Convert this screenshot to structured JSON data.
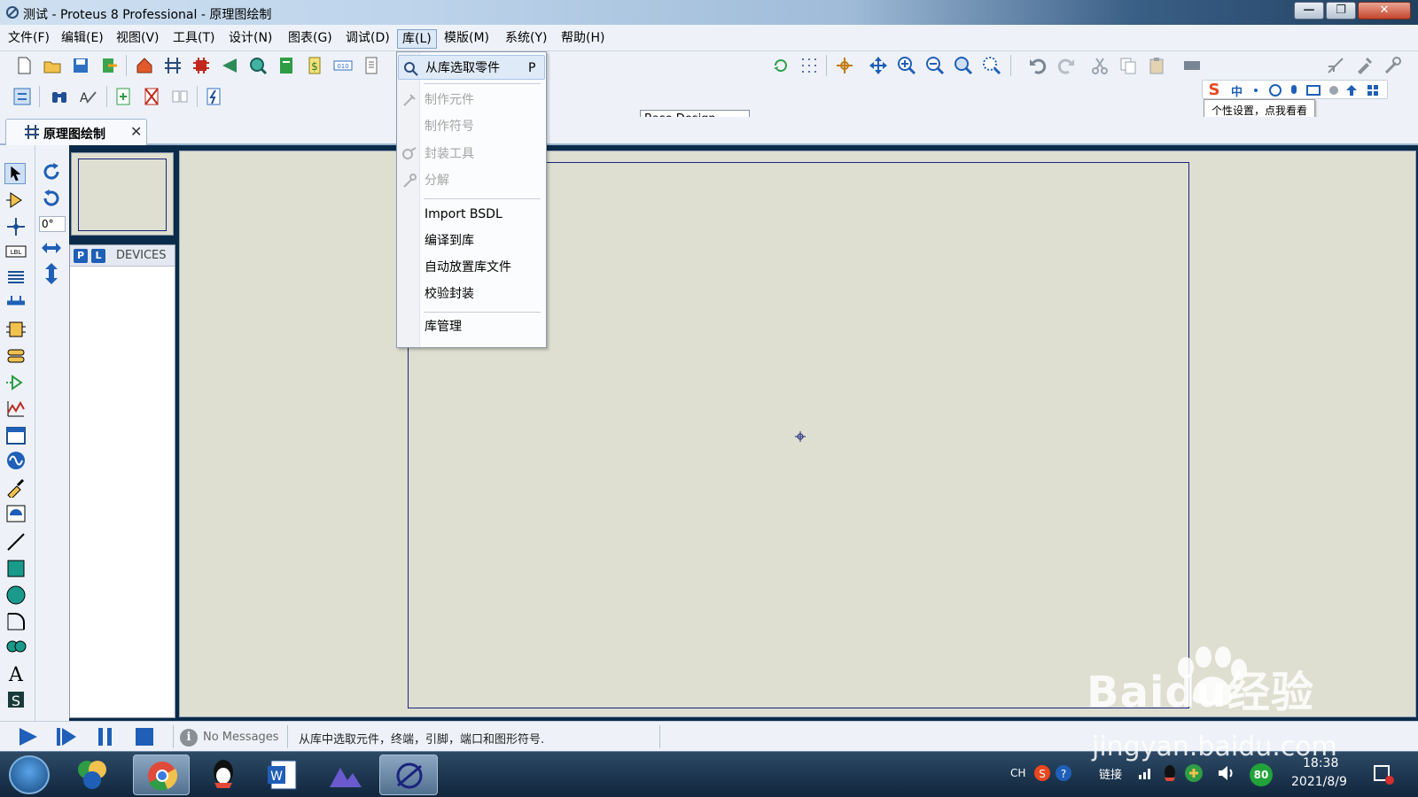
{
  "window": {
    "title": "测试 - Proteus 8 Professional - 原理图绘制",
    "close_glyph": "✕",
    "max_glyph": "❐",
    "min_glyph": "—"
  },
  "menubar": {
    "items": [
      "文件(F)",
      "编辑(E)",
      "视图(V)",
      "工具(T)",
      "设计(N)",
      "图表(G)",
      "调试(D)",
      "库(L)",
      "模版(M)",
      "系统(Y)",
      "帮助(H)"
    ],
    "active": "库(L)"
  },
  "toolbar": {
    "design_select": "Base Design",
    "tooltip": "个性设置，点我看看"
  },
  "tabs": {
    "doc_tab": "原理图绘制",
    "close": "✕"
  },
  "left_panel": {
    "angle": "0°",
    "pick_p": "P",
    "pick_l": "L",
    "devices_label": "DEVICES"
  },
  "library_menu": {
    "items": [
      {
        "label": "从库选取零件",
        "shortcut": "P",
        "enabled": true,
        "icon": "library-search-icon"
      },
      {
        "label": "制作元件",
        "enabled": false,
        "icon": "make-device-icon"
      },
      {
        "label": "制作符号",
        "enabled": false
      },
      {
        "label": "封装工具",
        "enabled": false,
        "icon": "package-tool-icon"
      },
      {
        "label": "分解",
        "enabled": false,
        "icon": "decompose-icon"
      },
      {
        "label": "Import BSDL",
        "enabled": true
      },
      {
        "label": "编译到库",
        "enabled": true
      },
      {
        "label": "自动放置库文件",
        "enabled": true
      },
      {
        "label": "校验封装",
        "enabled": true
      },
      {
        "label": "库管理",
        "enabled": true
      }
    ]
  },
  "statusbar": {
    "messages": "No Messages",
    "info_glyph": "i",
    "status": "从库中选取元件，终端，引脚，端口和图形符号."
  },
  "ime": {
    "logo": "S",
    "mode": "中"
  },
  "taskbar": {
    "lang": "CH",
    "network": "链接",
    "badge": "80",
    "time": "18:38",
    "date": "2021/8/9"
  },
  "watermark": {
    "line1": "Baidu经验",
    "line2": "jingyan.baidu.com"
  },
  "colors": {
    "canvas": "#dedfd0",
    "sheet_border": "#1a237e",
    "accent": "#1f5fb7"
  }
}
